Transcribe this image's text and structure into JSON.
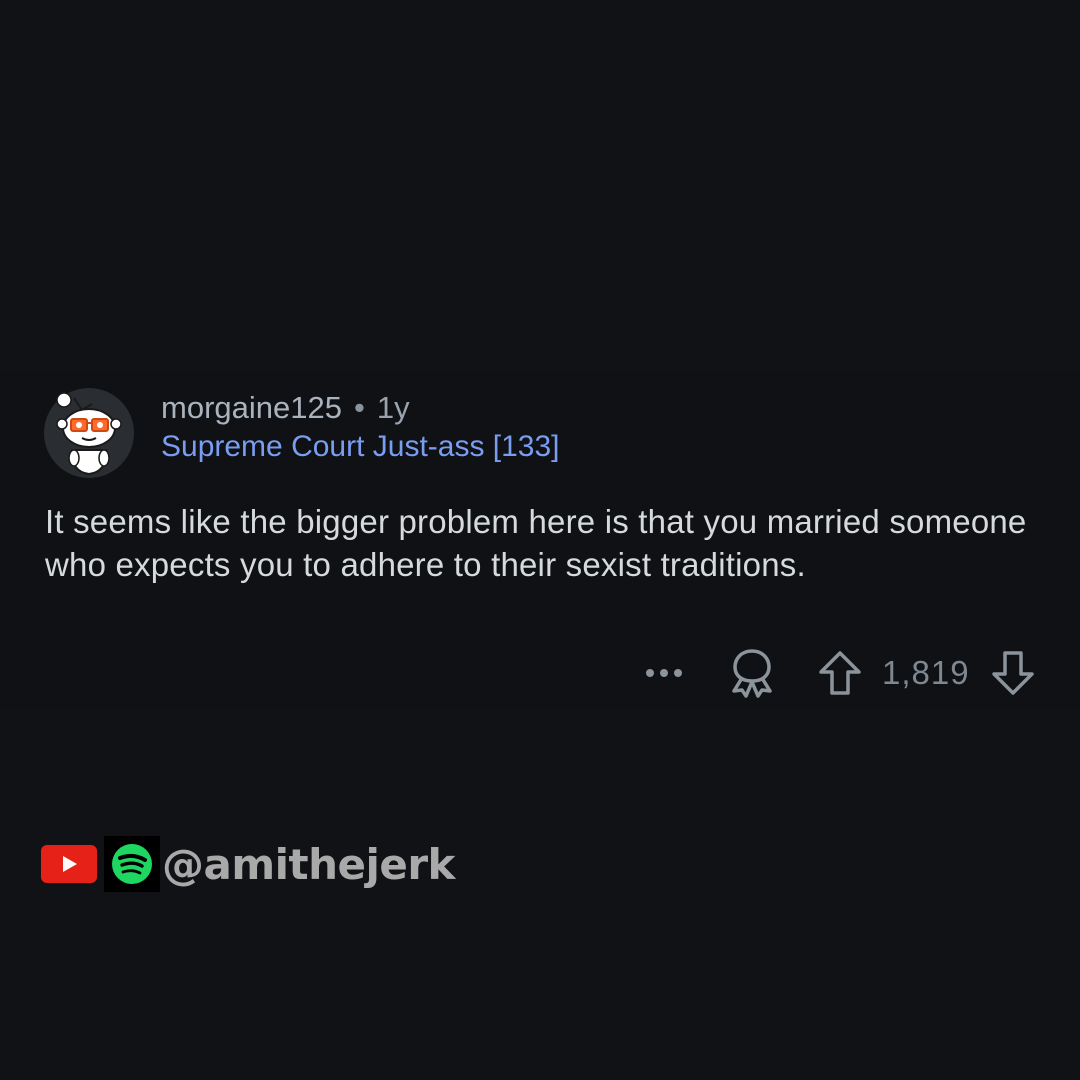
{
  "comment": {
    "username": "morgaine125",
    "separator": "•",
    "age": "1y",
    "flair": "Supreme Court Just-ass [133]",
    "body": "It seems like the bigger problem here is that you married someone who expects you to adhere to their sexist traditions.",
    "avatar_icon": "snoo-avatar-icon"
  },
  "actions": {
    "more_icon": "more-options-icon",
    "award_icon": "award-icon",
    "upvote_icon": "upvote-arrow-icon",
    "score": "1,819",
    "downvote_icon": "downvote-arrow-icon"
  },
  "social": {
    "youtube_icon": "youtube-icon",
    "spotify_icon": "spotify-icon",
    "handle": "@amithejerk"
  },
  "colors": {
    "background": "#101215",
    "flair": "#7a9df1",
    "body_text": "#d7dadc",
    "meta_text": "#9aa3ad",
    "youtube_red": "#e62117",
    "spotify_green": "#1ed760"
  }
}
